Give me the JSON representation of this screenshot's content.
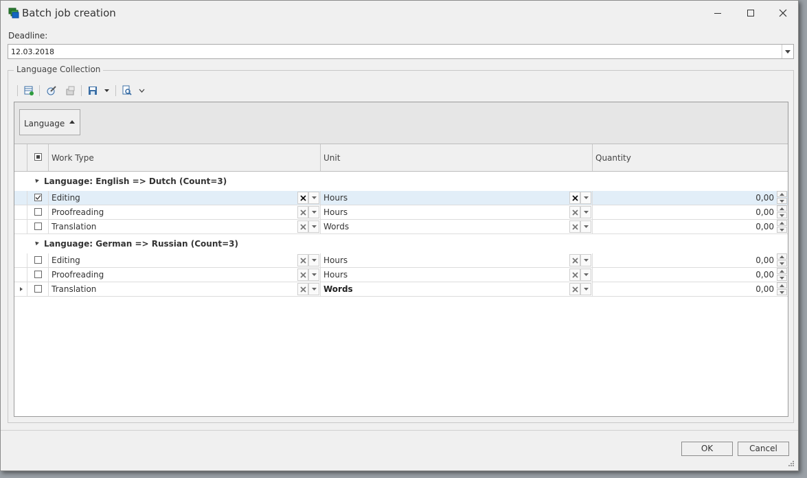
{
  "window": {
    "title": "Batch job creation",
    "app_icon": "stacked-documents-icon",
    "controls": [
      "minimize-icon",
      "maximize-icon",
      "close-icon"
    ]
  },
  "deadline": {
    "label": "Deadline:",
    "value": "12.03.2018"
  },
  "language_collection": {
    "title": "Language Collection",
    "toolbar": [
      "new-record-icon",
      "edit-icon",
      "delete-icon",
      "save-icon",
      "dropdown-arrow-icon",
      "find-icon",
      "chevron-down-icon"
    ],
    "group_panel": {
      "chip_label": "Language"
    },
    "columns": {
      "work_type": "Work Type",
      "unit": "Unit",
      "quantity": "Quantity"
    },
    "groups": [
      {
        "header": "Language: English => Dutch (Count=3)",
        "rows": [
          {
            "checked": true,
            "work_type": "Editing",
            "unit": "Hours",
            "quantity": "0,00"
          },
          {
            "checked": false,
            "work_type": "Proofreading",
            "unit": "Hours",
            "quantity": "0,00"
          },
          {
            "checked": false,
            "work_type": "Translation",
            "unit": "Words",
            "quantity": "0,00"
          }
        ]
      },
      {
        "header": "Language: German => Russian (Count=3)",
        "rows": [
          {
            "checked": false,
            "work_type": "Editing",
            "unit": "Hours",
            "quantity": "0,00"
          },
          {
            "checked": false,
            "work_type": "Proofreading",
            "unit": "Hours",
            "quantity": "0,00"
          },
          {
            "checked": false,
            "work_type": "Translation",
            "unit": "Words",
            "quantity": "0,00"
          }
        ]
      }
    ]
  },
  "buttons": {
    "ok": "OK",
    "cancel": "Cancel"
  },
  "colors": {
    "selected_row": "#e2eef8",
    "window_bg": "#f0f0f0"
  }
}
